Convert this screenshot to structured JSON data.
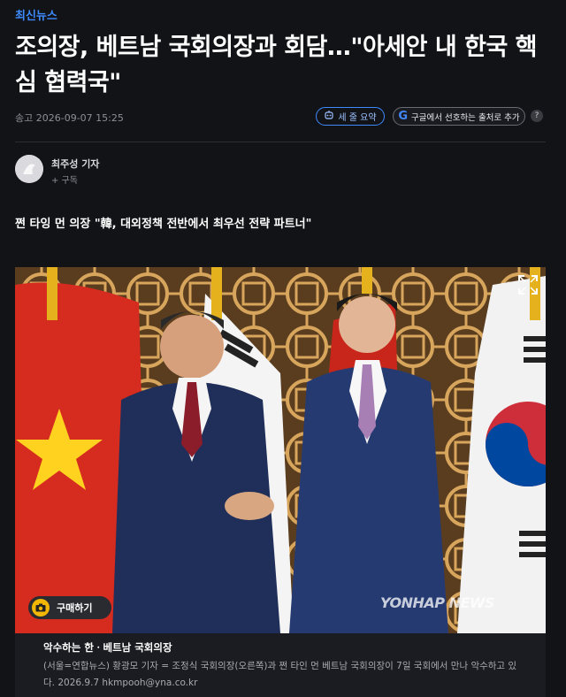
{
  "category": "최신뉴스",
  "headline": "조의장, 베트남 국회의장과 회담…\"아세안 내 한국 핵심 협력국\"",
  "meta": {
    "send_label": "송고",
    "date": "2026-09-07 15:25"
  },
  "actions": {
    "summary_label": "세 줄 요약",
    "google_label": "구글에서 선호하는 출처로 추가",
    "google_icon": "G",
    "help_label": "?"
  },
  "reporter": {
    "name": "최주성 기자",
    "subscribe": "+ 구독"
  },
  "subtitle": "쩐 타잉 먼 의장 \"韓, 대외정책 전반에서 최우선 전략 파트너\"",
  "photo": {
    "buy_label": "구매하기",
    "watermark": "YONHAP NEWS"
  },
  "caption": {
    "title": "악수하는 한ㆍ베트남 국회의장",
    "text": "(서울=연합뉴스) 황광모 기자 = 조정식 국회의장(오른쪽)과 쩐 타인 먼 베트남 국회의장이 7일 국회에서 만나 악수하고 있다. 2026.9.7 hkmpooh@yna.co.kr"
  },
  "colors": {
    "accent": "#3d8bff",
    "background": "#121317"
  }
}
